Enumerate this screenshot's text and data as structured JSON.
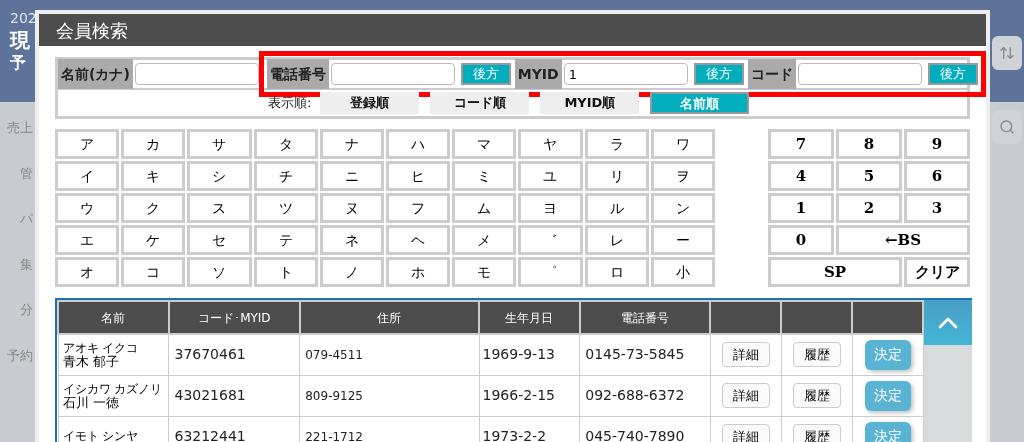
{
  "background": {
    "header_texts": [
      "202",
      "現",
      "予"
    ],
    "sidebar_items": [
      "売上",
      "管",
      "パ",
      "集",
      "分",
      "予約"
    ]
  },
  "dialog": {
    "title": "会員検索",
    "search_fields": [
      {
        "label": "名前(カナ)",
        "highlighted": false
      },
      {
        "label": "電話番号",
        "button": "後方",
        "highlighted": true
      },
      {
        "label": "MYID",
        "value": "1",
        "button": "後方",
        "highlighted": true
      },
      {
        "label": "コード",
        "button": "後方",
        "highlighted": true
      }
    ],
    "sort": {
      "label": "表示順:",
      "options": [
        {
          "label": "登録順",
          "selected": false
        },
        {
          "label": "コード順",
          "selected": false
        },
        {
          "label": "MYID順",
          "selected": false
        },
        {
          "label": "名前順",
          "selected": true
        }
      ]
    },
    "kana_keys": [
      [
        "ア",
        "カ",
        "サ",
        "タ",
        "ナ",
        "ハ",
        "マ",
        "ヤ",
        "ラ",
        "ワ"
      ],
      [
        "イ",
        "キ",
        "シ",
        "チ",
        "ニ",
        "ヒ",
        "ミ",
        "ユ",
        "リ",
        "ヲ"
      ],
      [
        "ウ",
        "ク",
        "ス",
        "ツ",
        "ヌ",
        "フ",
        "ム",
        "ヨ",
        "ル",
        "ン"
      ],
      [
        "エ",
        "ケ",
        "セ",
        "テ",
        "ネ",
        "ヘ",
        "メ",
        "゛",
        "レ",
        "ー"
      ],
      [
        "オ",
        "コ",
        "ソ",
        "ト",
        "ノ",
        "ホ",
        "モ",
        "゜",
        "ロ",
        "小"
      ]
    ],
    "number_keys": [
      {
        "label": "7",
        "kind": "normal"
      },
      {
        "label": "8",
        "kind": "normal"
      },
      {
        "label": "9",
        "kind": "normal"
      },
      {
        "label": "4",
        "kind": "normal"
      },
      {
        "label": "5",
        "kind": "normal"
      },
      {
        "label": "6",
        "kind": "normal"
      },
      {
        "label": "1",
        "kind": "normal"
      },
      {
        "label": "2",
        "kind": "normal"
      },
      {
        "label": "3",
        "kind": "normal"
      },
      {
        "label": "0",
        "kind": "normal"
      },
      {
        "label": "←BS",
        "kind": "wide"
      },
      {
        "label": "SP",
        "kind": "wide"
      },
      {
        "label": "クリア",
        "kind": "normal"
      }
    ],
    "table": {
      "columns": [
        "名前",
        "コード･MYID",
        "住所",
        "生年月日",
        "電話番号"
      ],
      "rows": [
        {
          "kana": "アオキ イクコ",
          "name": "青木 郁子",
          "code": "37670461",
          "address": "079-4511",
          "birthday": "1969-9-13",
          "phone": "0145-73-5845",
          "buttons": [
            "詳細",
            "履歴",
            "決定"
          ]
        },
        {
          "kana": "イシカワ カズノリ",
          "name": "石川 一徳",
          "code": "43021681",
          "address": "809-9125",
          "birthday": "1966-2-15",
          "phone": "092-688-6372",
          "buttons": [
            "詳細",
            "履歴",
            "決定"
          ]
        },
        {
          "kana": "イモト シンヤ",
          "code": "63212441",
          "address": "221-1712",
          "birthday": "1973-2-2",
          "phone": "045-740-7890",
          "buttons": [
            "詳細",
            "履歴",
            "決定"
          ]
        }
      ]
    }
  }
}
